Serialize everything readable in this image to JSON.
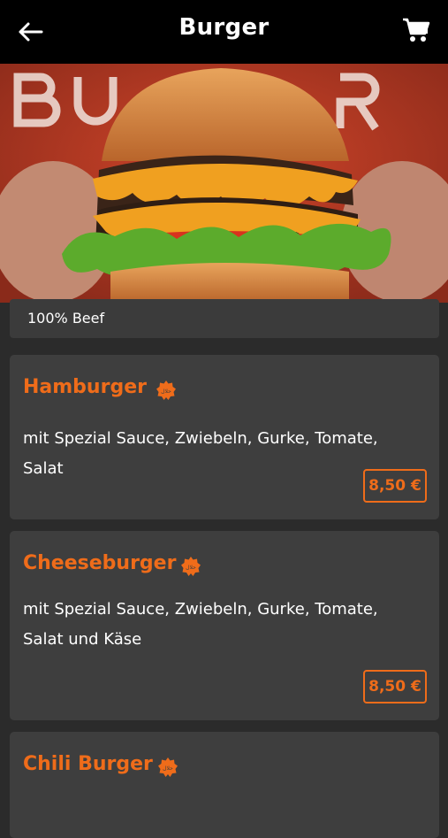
{
  "header": {
    "title": "Burger",
    "back_icon": "arrow-left-icon",
    "cart_icon": "shopping-cart-icon"
  },
  "hero": {
    "image": "burger-photo"
  },
  "category_note": "100% Beef",
  "colors": {
    "accent": "#ef6c1a",
    "card": "#3e3e3e",
    "background": "#2b2b2b",
    "topbar": "#000000"
  },
  "items": [
    {
      "name": "Hamburger",
      "description": "mit Spezial Sauce, Zwiebeln, Gurke, Tomate, Salat",
      "price": "8,50 €",
      "badge_icon": "halal-badge-icon"
    },
    {
      "name": "Cheeseburger",
      "description": "mit Spezial Sauce, Zwiebeln, Gurke, Tomate, Salat und Käse",
      "price": "8,50 €",
      "badge_icon": "halal-badge-icon"
    },
    {
      "name": "Chili Burger",
      "badge_icon": "halal-badge-icon"
    }
  ]
}
